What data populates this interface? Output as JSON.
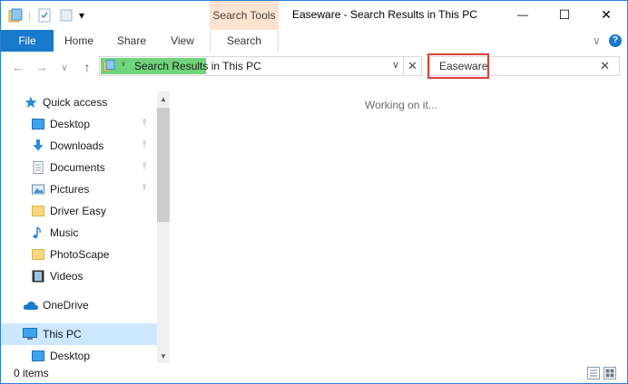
{
  "window": {
    "title": "Easeware - Search Results in This PC",
    "minimize_glyph": "—",
    "maximize_glyph": "☐",
    "close_glyph": "✕"
  },
  "quick_access_toolbar": {
    "dropdown_glyph": "▾"
  },
  "ribbon": {
    "context_tab_label": "Search Tools",
    "tabs": [
      {
        "label": "File"
      },
      {
        "label": "Home"
      },
      {
        "label": "Share"
      },
      {
        "label": "View"
      },
      {
        "label": "Search"
      }
    ],
    "collapse_glyph": "∨",
    "help_glyph": "?"
  },
  "navigation": {
    "back_glyph": "←",
    "forward_glyph": "→",
    "recent_glyph": "∨",
    "up_glyph": "↑",
    "address_chevron": "›",
    "address_text": "Search Results in This PC",
    "address_dropdown_glyph": "∨",
    "clear_address_glyph": "✕"
  },
  "search": {
    "value": "Easeware",
    "clear_glyph": "✕"
  },
  "nav_pane": {
    "pin_glyph": "📌",
    "items": [
      {
        "label": "Quick access",
        "icon": "star-icon"
      },
      {
        "label": "Desktop",
        "icon": "desktop-icon",
        "pinned": true
      },
      {
        "label": "Downloads",
        "icon": "download-icon",
        "pinned": true
      },
      {
        "label": "Documents",
        "icon": "documents-icon",
        "pinned": true
      },
      {
        "label": "Pictures",
        "icon": "pictures-icon",
        "pinned": true
      },
      {
        "label": "Driver Easy",
        "icon": "folder-icon"
      },
      {
        "label": "Music",
        "icon": "music-icon"
      },
      {
        "label": "PhotoScape",
        "icon": "folder-icon"
      },
      {
        "label": "Videos",
        "icon": "videos-icon"
      },
      {
        "label": "OneDrive",
        "icon": "cloud-icon"
      },
      {
        "label": "This PC",
        "icon": "computer-icon",
        "selected": true
      },
      {
        "label": "Desktop",
        "icon": "desktop-icon"
      }
    ],
    "scroll_up_glyph": "▲",
    "scroll_down_glyph": "▼"
  },
  "content": {
    "status_message": "Working on it..."
  },
  "status_bar": {
    "item_count": "0 items"
  },
  "colors": {
    "file_tab": "#1979ca",
    "context_tab": "#fbe3cf",
    "address_progress": "#6fd47a",
    "search_highlight": "#d9423a",
    "selected_item": "#cce8ff"
  }
}
